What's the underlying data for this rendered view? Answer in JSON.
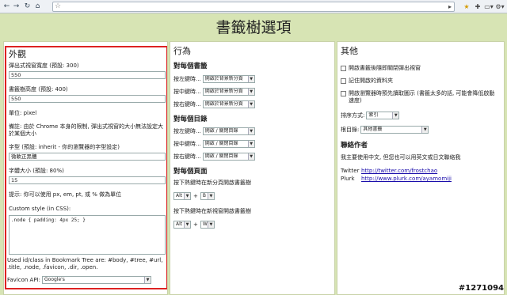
{
  "page_title": "書籤樹選項",
  "look": {
    "heading": "外觀",
    "popup_width_label": "彈出式視窗寬度 (預設: 300)",
    "popup_width_value": "550",
    "tree_height_label": "書籤樹高度 (預設: 400)",
    "tree_height_value": "550",
    "unit_label": "單位: pixel",
    "note_chrome": "備註: 由於 Chrome 本身的限制, 彈出式視窗的大小無法設定大於某個大小",
    "font_label": "字型 (預設: inherit - 你的瀏覽器的字型設定)",
    "font_value": "微軟正黑體",
    "font_size_label": "字體大小 (預設: 80%)",
    "font_size_value": "15",
    "hint_units": "提示: 你可以使用 px, em, pt, 或 % 做為單位",
    "custom_style_label": "Custom style (in CSS):",
    "custom_style_value": ".node { padding: 4px 25; }",
    "ids_note": "Used id/class in Bookmark Tree are: #body, #tree, #url, .title, .node, .favicon, .dir, .open.",
    "favicon_label": "Favicon API:",
    "favicon_value": "Google's"
  },
  "behavior": {
    "heading": "行為",
    "each_bookmark_heading": "對每個書籤",
    "each_folder_heading": "對每個目錄",
    "each_page_heading": "對每個頁面",
    "bookmark_rows": [
      {
        "label": "按左鍵時...",
        "value": "開啟於背景新分頁"
      },
      {
        "label": "按中鍵時...",
        "value": "開啟於背景新分頁"
      },
      {
        "label": "按右鍵時...",
        "value": "開啟於背景新分頁"
      }
    ],
    "folder_rows": [
      {
        "label": "按左鍵時...",
        "value": "開啟 / 關閉目錄"
      },
      {
        "label": "按中鍵時...",
        "value": "開啟 / 關閉目錄"
      },
      {
        "label": "按右鍵時...",
        "value": "開啟 / 關閉目錄"
      }
    ],
    "new_tab_hotkey_label": "按下熱鍵時在新分頁開啟書籤樹",
    "new_tab_mod": "Alt",
    "new_tab_key": "B",
    "new_window_hotkey_label": "按下熱鍵時在新視窗開啟書籤樹",
    "new_window_mod": "Alt",
    "new_window_key": "W",
    "plus": "+"
  },
  "other": {
    "heading": "其他",
    "opt_close_popup": "開啟書籤後隨即關閉彈出視窗",
    "opt_remember_folder": "記住開啟的資料夾",
    "opt_preload_icons": "開啟瀏覽器時預先讀取圖示 (書籤太多的話, 可能會降低啟動速度)",
    "sort_label": "排序方式:",
    "sort_value": "索引",
    "root_label": "根目錄:",
    "root_value": "其他書籤",
    "contact_heading": "聯絡作者",
    "contact_text": "我主要使用中文, 但您也可以用英文或日文聯絡我",
    "twitter_label": "Twitter",
    "twitter_url": "http://twitter.com/frostchao",
    "plurk_label": "Plurk",
    "plurk_url": "http://www.plurk.com/ayamomiji"
  },
  "watermark": "#1271094"
}
